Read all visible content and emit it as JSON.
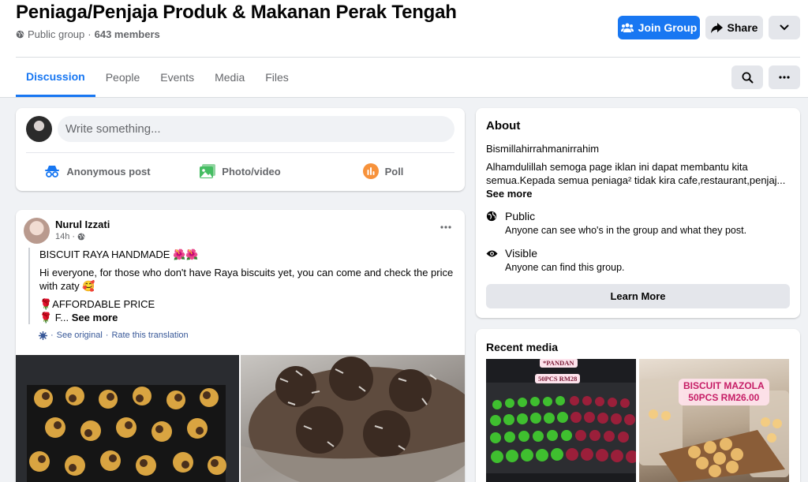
{
  "group": {
    "title": "Peniaga/Penjaja Produk & Makanan Perak Tengah",
    "privacy": "Public group",
    "separator": "·",
    "members": "643 members"
  },
  "header_buttons": {
    "join": "Join Group",
    "share": "Share"
  },
  "tabs": [
    {
      "label": "Discussion",
      "active": true
    },
    {
      "label": "People",
      "active": false
    },
    {
      "label": "Events",
      "active": false
    },
    {
      "label": "Media",
      "active": false
    },
    {
      "label": "Files",
      "active": false
    }
  ],
  "composer": {
    "placeholder": "Write something...",
    "actions": [
      {
        "label": "Anonymous post",
        "icon": "incognito-icon",
        "color": "#1877f2"
      },
      {
        "label": "Photo/video",
        "icon": "photo-icon",
        "color": "#45bd62"
      },
      {
        "label": "Poll",
        "icon": "poll-icon",
        "color": "#f7923b"
      }
    ]
  },
  "post": {
    "author": "Nurul Izzati",
    "time": "14h",
    "time_separator": "·",
    "lines": {
      "title": "BISCUIT RAYA HANDMADE 🌺🌺",
      "body": "Hi everyone, for those who don't have Raya biscuits yet, you can come and check the price with zaty 🥰",
      "bullet1": "🌹AFFORDABLE PRICE",
      "bullet2": "🌹 F...",
      "see_more": "See more"
    },
    "translation": {
      "see_original": "See original",
      "separator": "·",
      "rate": "Rate this translation"
    }
  },
  "about": {
    "title": "About",
    "line1": "Bismillahirrahmanirrahim",
    "line2": "Alhamdulillah semoga page iklan ini dapat membantu kita semua.Kepada semua peniaga² tidak kira cafe,restaurant,penjaj...",
    "see_more": "See more",
    "public_title": "Public",
    "public_sub": "Anyone can see who's in the group and what they post.",
    "visible_title": "Visible",
    "visible_sub": "Anyone can find this group.",
    "learn_more": "Learn More"
  },
  "recent_media": {
    "title": "Recent media",
    "label_a1": "*PANDAN",
    "label_a2": "50PCS RM28",
    "label_b1": "BISCUIT MAZOLA",
    "label_b2": "50PCS RM26.00"
  },
  "colors": {
    "accent": "#1877f2",
    "secondary_button": "#e4e6eb",
    "page_background": "#f0f2f5",
    "muted_text": "#65676b"
  }
}
